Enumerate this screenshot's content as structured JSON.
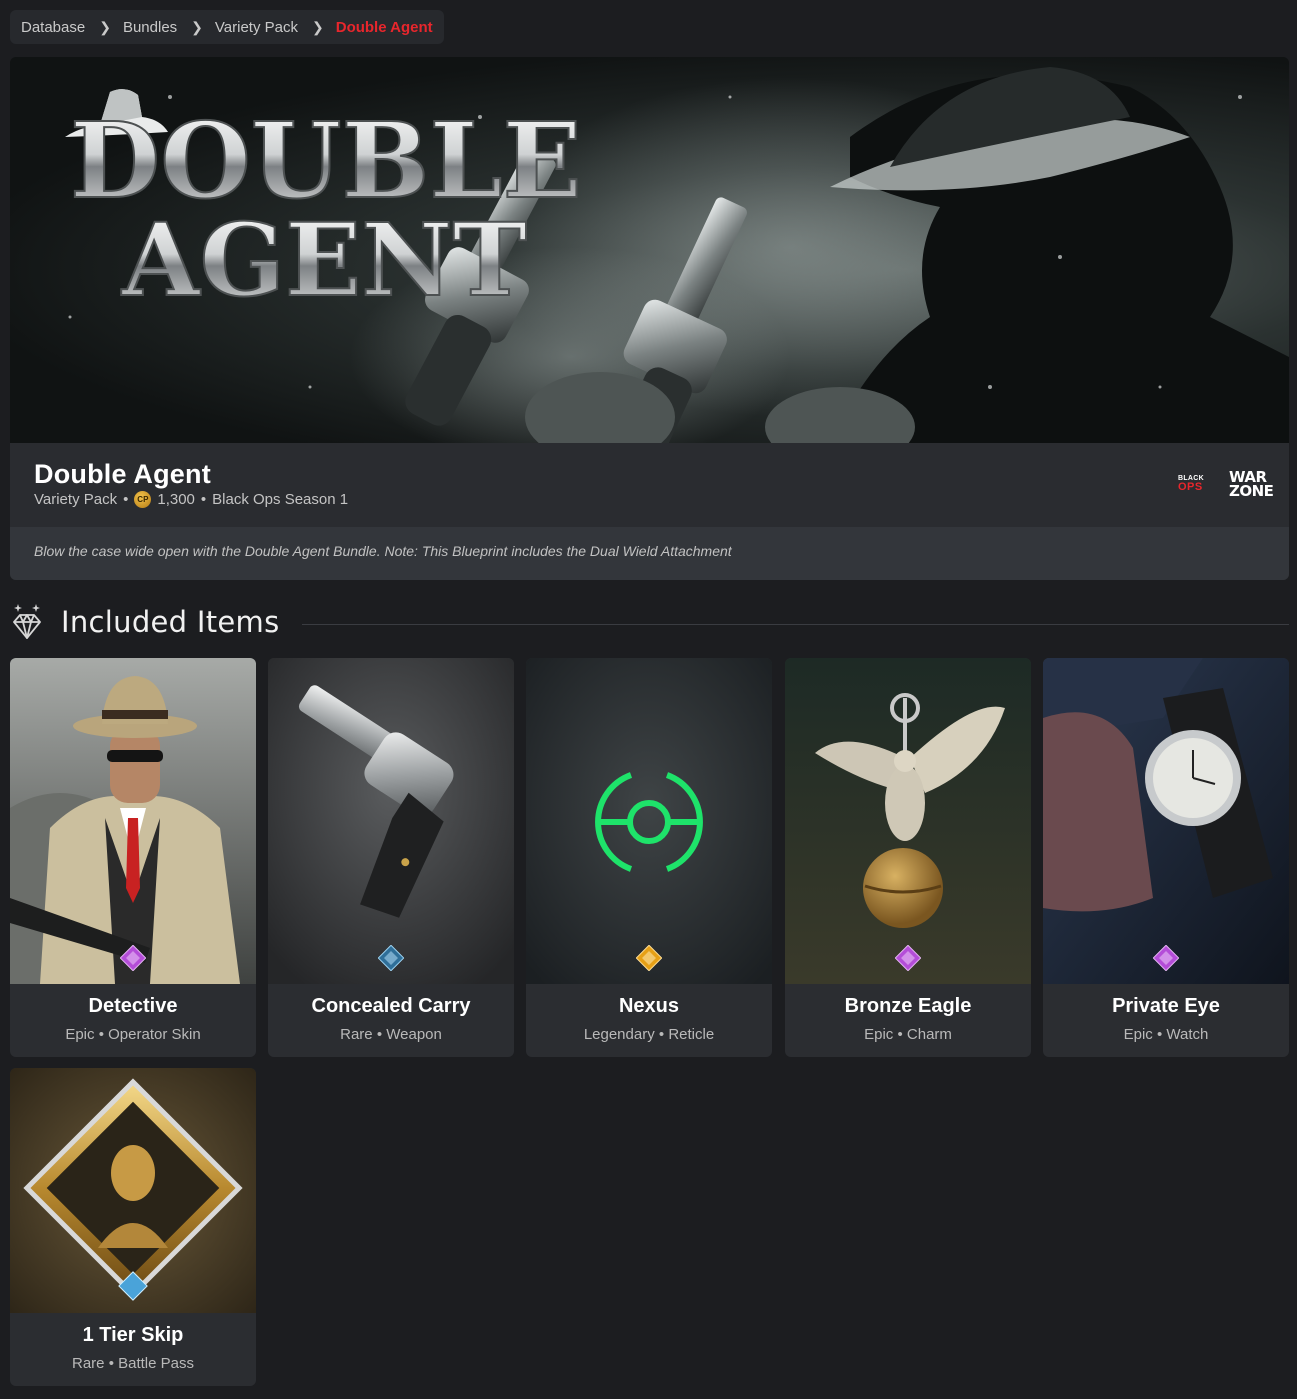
{
  "breadcrumb": [
    "Database",
    "Bundles",
    "Variety Pack",
    "Double Agent"
  ],
  "hero": {
    "logo_line1": "DOUBLE",
    "logo_line2": "AGENT",
    "title": "Double Agent",
    "pack": "Variety Pack",
    "currency_icon": "CP",
    "price": "1,300",
    "season": "Black Ops Season 1",
    "game_logos": {
      "blackops_top": "BLACK",
      "blackops_bottom": "OPS",
      "warzone_top": "WAR",
      "warzone_bottom": "ZONE"
    },
    "description": "Blow the case wide open with the Double Agent Bundle. Note: This Blueprint includes the Dual Wield Attachment"
  },
  "section": {
    "title": "Included Items",
    "icon": "diamond-icon"
  },
  "items": [
    {
      "name": "Detective",
      "rarity": "Epic",
      "type": "Operator Skin",
      "rarity_color": "#b44dd8"
    },
    {
      "name": "Concealed Carry",
      "rarity": "Rare",
      "type": "Weapon",
      "rarity_color": "#4aa3d9"
    },
    {
      "name": "Nexus",
      "rarity": "Legendary",
      "type": "Reticle",
      "rarity_color": "#e6a016"
    },
    {
      "name": "Bronze Eagle",
      "rarity": "Epic",
      "type": "Charm",
      "rarity_color": "#b44dd8"
    },
    {
      "name": "Private Eye",
      "rarity": "Epic",
      "type": "Watch",
      "rarity_color": "#b44dd8"
    },
    {
      "name": "1 Tier Skip",
      "rarity": "Rare",
      "type": "Battle Pass",
      "rarity_color": "#4aa3d9"
    }
  ],
  "separator": "•",
  "colors": {
    "accent": "#e8262c",
    "reticle": "#1ee36a",
    "background": "#1c1d20",
    "card": "#2b2d31"
  }
}
